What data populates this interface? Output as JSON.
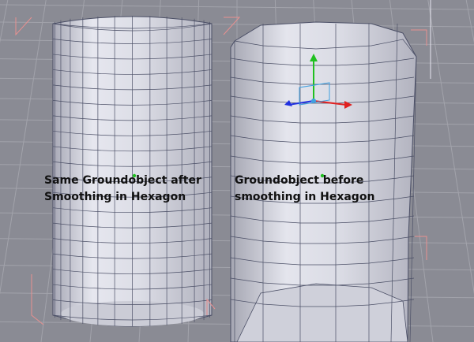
{
  "viewport": {
    "background_color": "#8a8b94",
    "grid_color": "#a2a3ab",
    "mesh_fill_color": "#d8d9e2",
    "mesh_wire_color": "#4b4f66"
  },
  "annotations": {
    "smoothed_object_label": "Same Groundobject after\nSmoothing in Hexagon",
    "original_object_label": "Groundobject before\nsmoothing in Hexagon"
  },
  "gizmo": {
    "x_axis_color": "#e02020",
    "y_axis_color": "#20c020",
    "z_axis_color": "#2030e0",
    "center_color": "#40a0e0"
  },
  "icons": {
    "transform_gizmo": "move-gizmo-icon"
  }
}
